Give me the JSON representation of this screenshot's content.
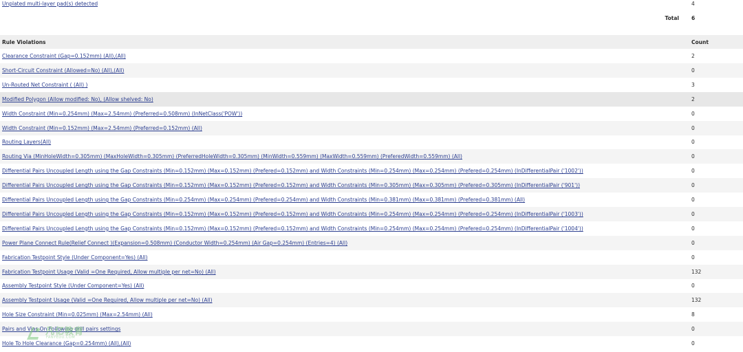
{
  "top_row": {
    "name": "Unplated multi-layer pad(s) detected",
    "count": "4"
  },
  "total": {
    "label": "Total",
    "value": "6"
  },
  "violations_table": {
    "header_name": "Rule Violations",
    "header_count": "Count",
    "rows": [
      {
        "name": "Clearance Constraint (Gap=0.152mm) (All),(All)",
        "count": "2"
      },
      {
        "name": "Short-Circuit Constraint (Allowed=No) (All),(All)",
        "count": "0"
      },
      {
        "name": "Un-Routed Net Constraint ( (All) )",
        "count": "3"
      },
      {
        "name": "Modified Polygon (Allow modified: No), (Allow shelved: No)",
        "count": "2"
      },
      {
        "name": "Width Constraint (Min=0.254mm) (Max=2.54mm) (Preferred=0.508mm) (InNetClass('POW'))",
        "count": "0"
      },
      {
        "name": "Width Constraint (Min=0.152mm) (Max=2.54mm) (Preferred=0.152mm) (All)",
        "count": "0"
      },
      {
        "name": "Routing Layers(All)",
        "count": "0"
      },
      {
        "name": "Routing Via (MinHoleWidth=0.305mm) (MaxHoleWidth=0.305mm) (PreferredHoleWidth=0.305mm) (MinWidth=0.559mm) (MaxWidth=0.559mm) (PreferedWidth=0.559mm) (All)",
        "count": "0"
      },
      {
        "name": "Differential Pairs Uncoupled Length using the Gap Constraints (Min=0.152mm) (Max=0.152mm) (Prefered=0.152mm) and Width Constraints (Min=0.254mm) (Max=0.254mm) (Prefered=0.254mm) (InDifferentialPair ('1002'))",
        "count": "0"
      },
      {
        "name": "Differential Pairs Uncoupled Length using the Gap Constraints (Min=0.152mm) (Max=0.152mm) (Prefered=0.152mm) and Width Constraints (Min=0.305mm) (Max=0.305mm) (Prefered=0.305mm) (InDifferentialPair ('901'))",
        "count": "0"
      },
      {
        "name": "Differential Pairs Uncoupled Length using the Gap Constraints (Min=0.254mm) (Max=0.254mm) (Prefered=0.254mm) and Width Constraints (Min=0.381mm) (Max=0.381mm) (Prefered=0.381mm) (All)",
        "count": "0"
      },
      {
        "name": "Differential Pairs Uncoupled Length using the Gap Constraints (Min=0.152mm) (Max=0.152mm) (Prefered=0.152mm) and Width Constraints (Min=0.254mm) (Max=0.254mm) (Prefered=0.254mm) (InDifferentialPair ('1003'))",
        "count": "0"
      },
      {
        "name": "Differential Pairs Uncoupled Length using the Gap Constraints (Min=0.152mm) (Max=0.152mm) (Prefered=0.152mm) and Width Constraints (Min=0.254mm) (Max=0.254mm) (Prefered=0.254mm) (InDifferentialPair ('1004'))",
        "count": "0"
      },
      {
        "name": "Power Plane Connect Rule(Relief Connect )(Expansion=0.508mm) (Conductor Width=0.254mm) (Air Gap=0.254mm) (Entries=4) (All)",
        "count": "0"
      },
      {
        "name": "Fabrication Testpoint Style (Under Component=Yes) (All)",
        "count": "0"
      },
      {
        "name": "Fabrication Testpoint Usage (Valid =One Required, Allow multiple per net=No) (All)",
        "count": "132"
      },
      {
        "name": "Assembly Testpoint Style (Under Component=Yes) (All)",
        "count": "0"
      },
      {
        "name": "Assembly Testpoint Usage (Valid =One Required, Allow multiple per net=No) (All)",
        "count": "132"
      },
      {
        "name": "Hole Size Constraint (Min=0.025mm) (Max=2.54mm) (All)",
        "count": "8"
      },
      {
        "name": "Pairs and Vias On Following drill pairs settings",
        "count": "0"
      },
      {
        "name": "Hole To Hole Clearance (Gap=0.254mm) (All),(All)",
        "count": "0"
      }
    ]
  },
  "watermark": {
    "text": "凡亿教育",
    "subtext": "FANYEDU.COM"
  },
  "colors": {
    "link": "#2a3d8f",
    "row_alt": "#f4f4f4",
    "row_highlight": "#e7e7e7",
    "header_bg": "#efefef",
    "watermark": "#7cc57b"
  }
}
